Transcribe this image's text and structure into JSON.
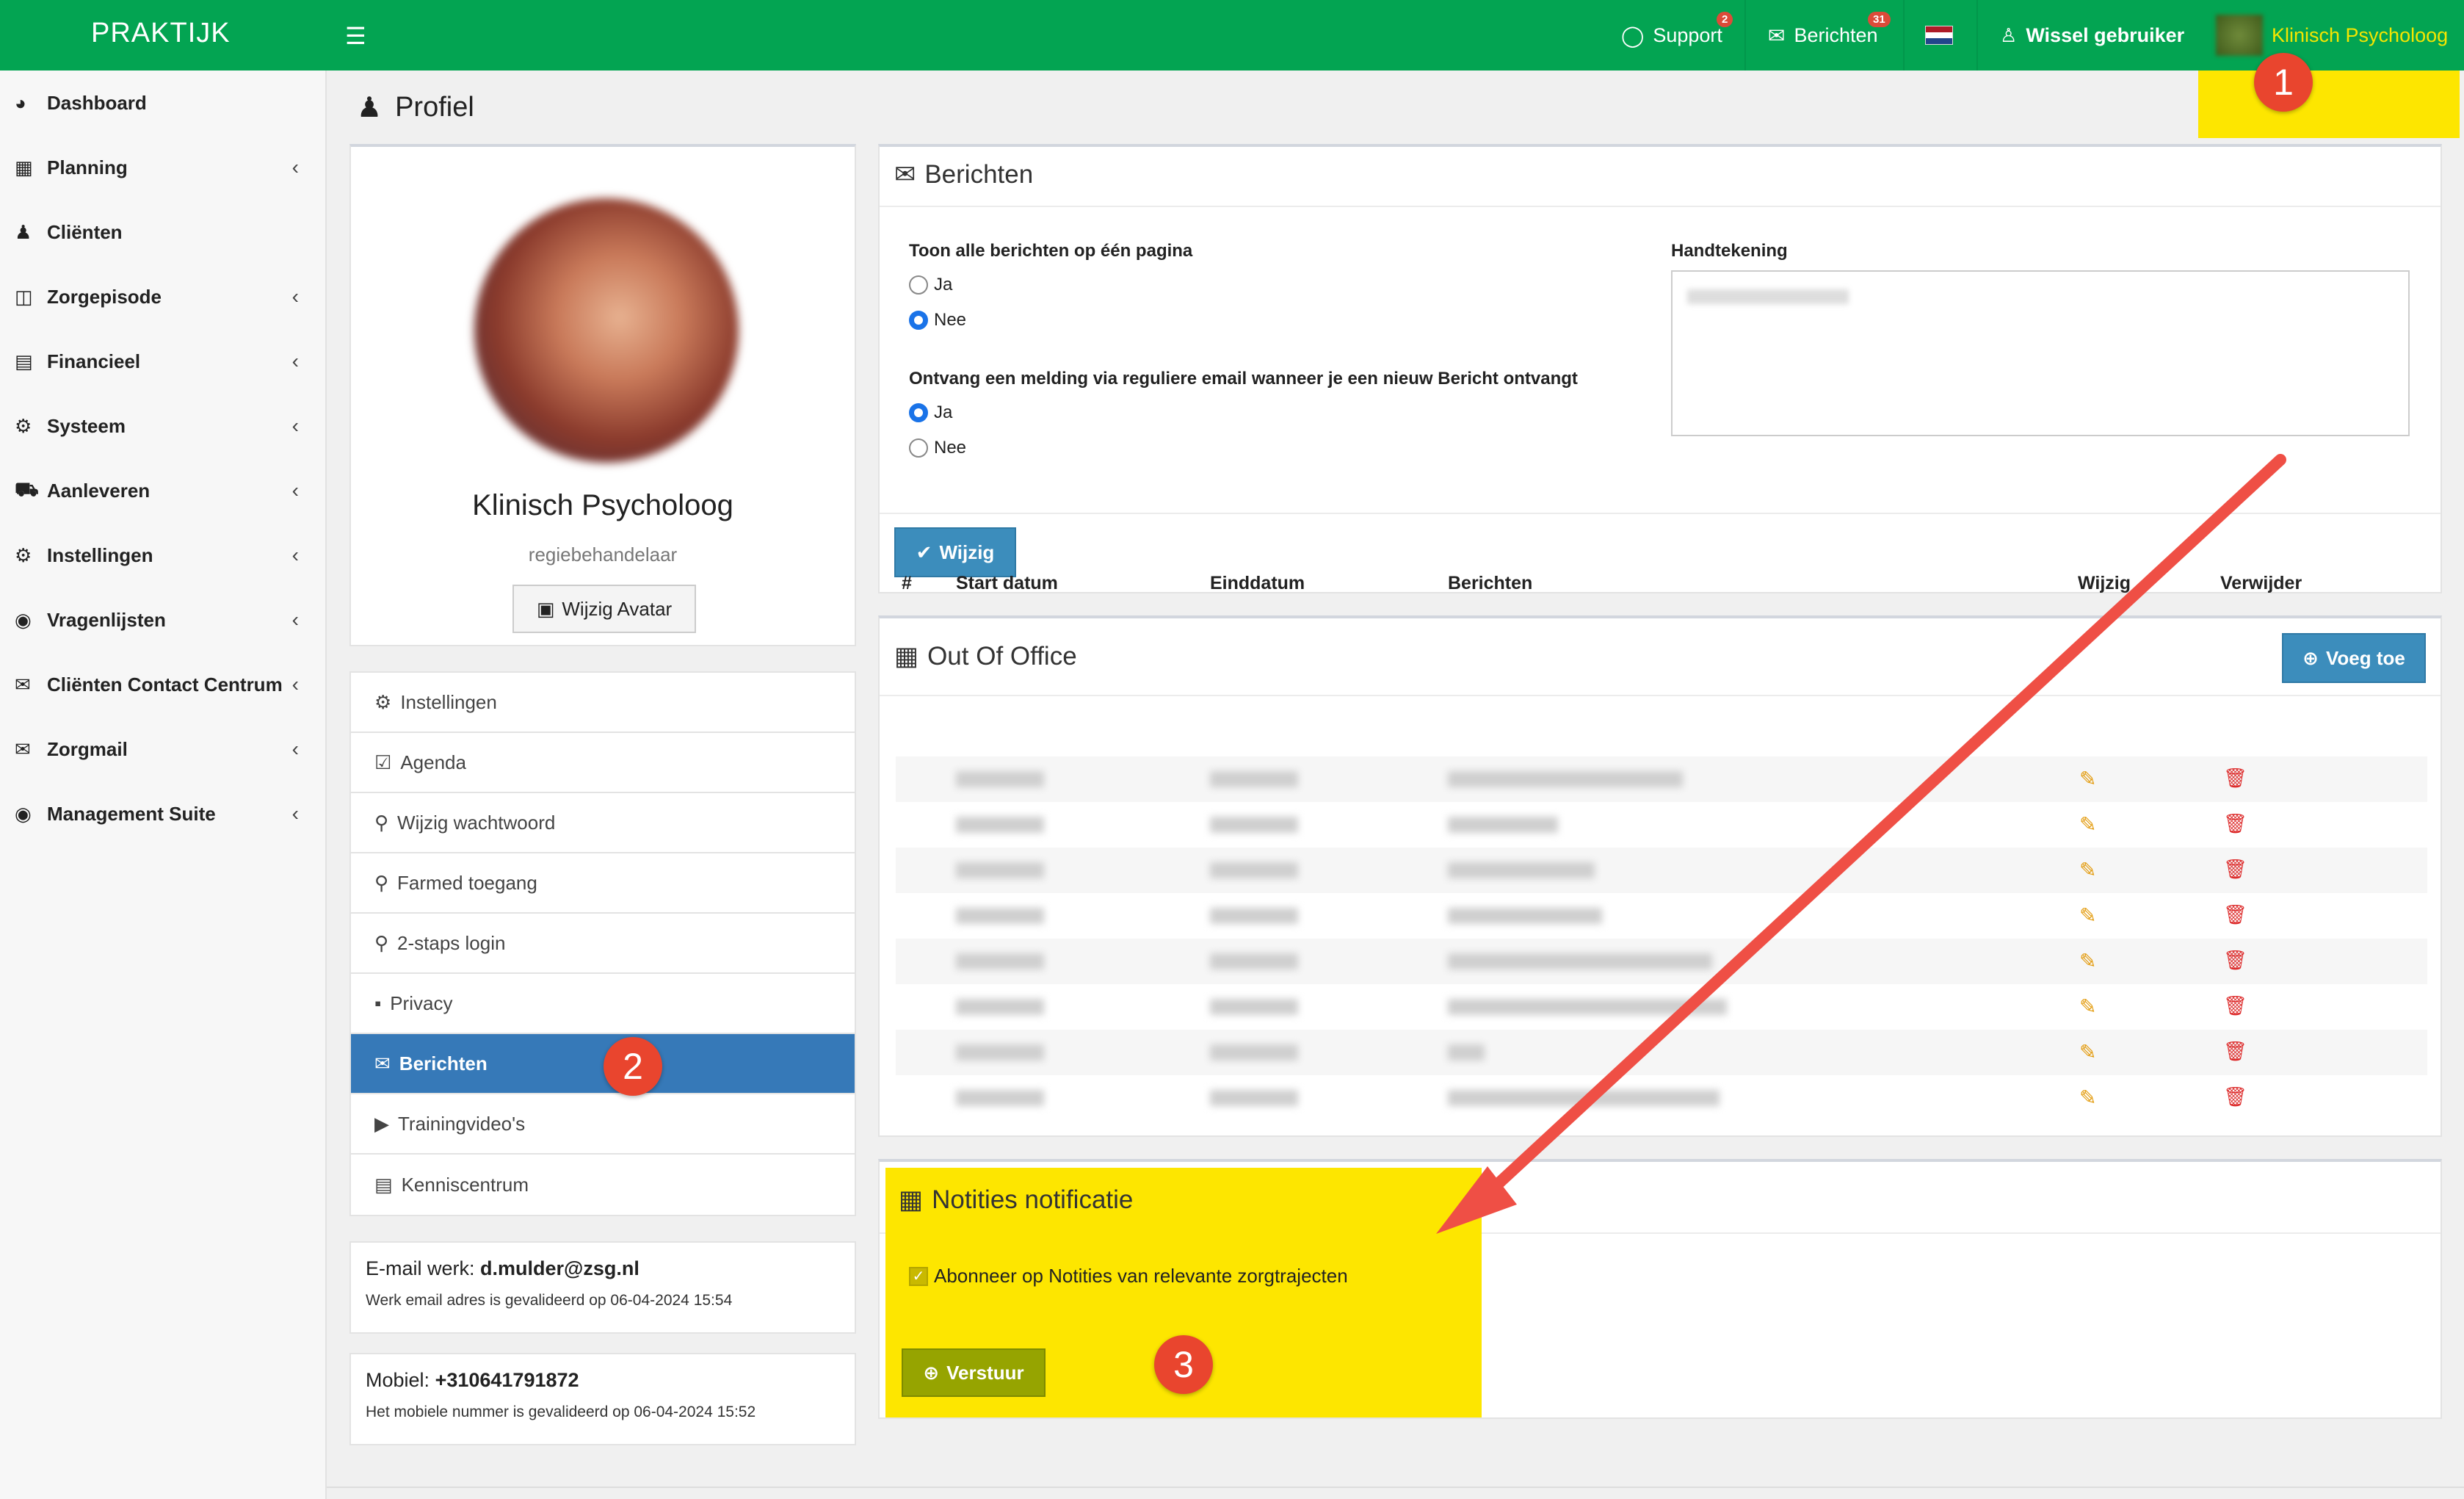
{
  "topbar": {
    "brand": "PRAKTIJK",
    "menu_icon": "hamburger-icon",
    "support_label": "Support",
    "support_badge": "2",
    "messages_label": "Berichten",
    "messages_badge": "31",
    "switch_user_label": "Wissel gebruiker",
    "user_name": "Klinisch Psycholoog"
  },
  "sidebar": {
    "items": [
      {
        "label": "Dashboard",
        "icon": "dashboard-icon"
      },
      {
        "label": "Planning",
        "icon": "calendar-icon"
      },
      {
        "label": "Cliënten",
        "icon": "user-icon"
      },
      {
        "label": "Zorgepisode",
        "icon": "medkit-icon"
      },
      {
        "label": "Financieel",
        "icon": "book-icon"
      },
      {
        "label": "Systeem",
        "icon": "cogs-icon"
      },
      {
        "label": "Aanleveren",
        "icon": "truck-icon"
      },
      {
        "label": "Instellingen",
        "icon": "gear-icon"
      },
      {
        "label": "Vragenlijsten",
        "icon": "globe-icon"
      },
      {
        "label": "Cliënten Contact Centrum",
        "icon": "envelope-icon"
      },
      {
        "label": "Zorgmail",
        "icon": "envelope-icon"
      },
      {
        "label": "Management Suite",
        "icon": "globe-icon"
      }
    ]
  },
  "page": {
    "title": "Profiel"
  },
  "profile": {
    "name": "Klinisch Psycholoog",
    "role": "regiebehandelaar",
    "change_avatar": "Wijzig Avatar"
  },
  "profile_menu": {
    "items": [
      {
        "label": "Instellingen",
        "icon": "cogs-icon"
      },
      {
        "label": "Agenda",
        "icon": "calendar-check-icon"
      },
      {
        "label": "Wijzig wachtwoord",
        "icon": "key-icon"
      },
      {
        "label": "Farmed toegang",
        "icon": "key-icon"
      },
      {
        "label": "2-staps login",
        "icon": "key-icon"
      },
      {
        "label": "Privacy",
        "icon": "lock-icon"
      },
      {
        "label": "Berichten",
        "icon": "envelope-icon"
      },
      {
        "label": "Trainingvideo's",
        "icon": "play-icon"
      },
      {
        "label": "Kenniscentrum",
        "icon": "book-icon"
      }
    ]
  },
  "contact": {
    "email_label": "E-mail werk:",
    "email_value": "d.mulder@zsg.nl",
    "email_note": "Werk email adres is gevalideerd op 06-04-2024 15:54",
    "mobile_label": "Mobiel:",
    "mobile_value": "+310641791872",
    "mobile_note": "Het mobiele nummer is gevalideerd op 06-04-2024 15:52"
  },
  "messages_panel": {
    "title": "Berichten",
    "q1": "Toon alle berichten op één pagina",
    "q1_yes": "Ja",
    "q1_no": "Nee",
    "q2": "Ontvang een melding via reguliere email wanneer je een nieuw Bericht ontvangt",
    "q2_yes": "Ja",
    "q2_no": "Nee",
    "signature_label": "Handtekening",
    "save_button": "Wijzig"
  },
  "ooo_panel": {
    "title": "Out Of Office",
    "add_button": "Voeg toe",
    "columns": [
      "#",
      "Start datum",
      "Einddatum",
      "Berichten",
      "Wijzig",
      "Verwijder"
    ]
  },
  "notes_panel": {
    "title": "Notities notificatie",
    "checkbox_label": "Abonneer op Notities van relevante zorgtrajecten",
    "send_button": "Verstuur"
  },
  "callouts": {
    "one": "1",
    "two": "2",
    "three": "3"
  },
  "colors": {
    "topbar": "#03a452",
    "highlight": "#fde600",
    "active": "#3679b8",
    "callout": "#e9452e"
  }
}
